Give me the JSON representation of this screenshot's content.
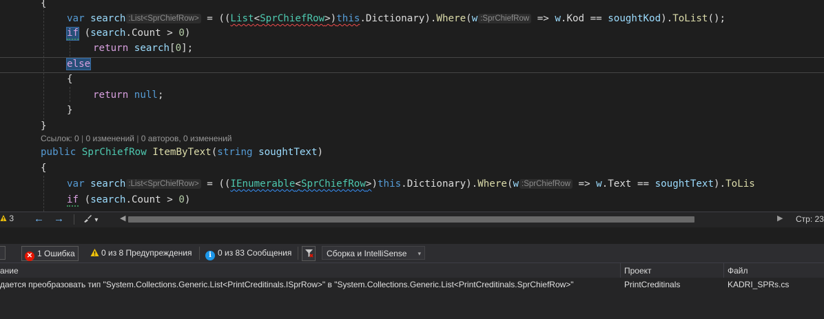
{
  "editor": {
    "l1": {
      "brace": "{"
    },
    "l2": {
      "var": "var",
      "name": "search",
      "hint": ":List<SprChiefRow>",
      "eq": " = ((",
      "list": "List",
      "lt": "<",
      "type": "SprChiefRow",
      "gt": ">",
      "close": ")",
      "this": "this",
      "dict": ".Dictionary).",
      "where": "Where",
      "open": "(",
      "w": "w",
      "whint": ":SprChiefRow",
      "arrow": " => ",
      "w2": "w",
      "dot": ".",
      "kod": "Kod",
      "eqeq": " == ",
      "sought": "soughtKod",
      "end1": ").",
      "tolist": "ToList",
      "end2": "();"
    },
    "l3": {
      "if": "if",
      "rest1": " (",
      "search": "search",
      "rest2": ".Count > ",
      "zero": "0",
      "rest3": ")"
    },
    "l4": {
      "return": "return",
      "sp": " ",
      "search": "search",
      "b1": "[",
      "zero": "0",
      "b2": "];"
    },
    "l5": {
      "else": "else"
    },
    "l6": {
      "brace": "{"
    },
    "l7": {
      "return": "return",
      "sp": " ",
      "null": "null",
      "semi": ";"
    },
    "l8": {
      "brace": "}"
    },
    "l9": {
      "brace": "}"
    },
    "codelens": {
      "refs": "Ссылок: 0",
      "changes": "0 изменений",
      "authors": "0 авторов, 0 изменений"
    },
    "l10": {
      "public": "public",
      "type": "SprChiefRow",
      "method": "ItemByText",
      "open": "(",
      "string": "string",
      "param": "soughtText",
      "close": ")"
    },
    "l11": {
      "brace": "{"
    },
    "l12": {
      "var": "var",
      "name": "search",
      "hint": ":List<SprChiefRow>",
      "eq": " = ((",
      "ienum": "IEnumerable",
      "lt": "<",
      "type": "SprChiefRow",
      "gt": ">",
      "close": ")",
      "this": "this",
      "dict": ".Dictionary).",
      "where": "Where",
      "open": "(",
      "w": "w",
      "whint": ":SprChiefRow",
      "arrow": " => ",
      "w2": "w",
      "dot": ".",
      "text": "Text",
      "eqeq": " == ",
      "sought": "soughtText",
      "end1": ").",
      "tolist": "ToLis"
    },
    "l13": {
      "if": "if",
      "rest1": " (",
      "search": "search",
      "rest2": ".Count > ",
      "zero": "0",
      "rest3": ")"
    }
  },
  "editor_status": {
    "warnings_count": "3",
    "back_icon": "arrow-left-icon",
    "forward_icon": "arrow-right-icon",
    "brush_icon": "brush-icon",
    "dropdown": "▾",
    "position": "Стр: 23"
  },
  "error_list": {
    "toolbar": {
      "errors": "1 Ошибка",
      "warnings": "0 из 8 Предупреждения",
      "messages": "0 из 83 Сообщения",
      "filter_icon": "filter-clear-icon",
      "scope": "Сборка и IntelliSense"
    },
    "columns": {
      "description": "ание",
      "project": "Проект",
      "file": "Файл"
    },
    "rows": [
      {
        "description": "дается преобразовать тип \"System.Collections.Generic.List<PrintCreditinals.ISprRow>\" в \"System.Collections.Generic.List<PrintCreditinals.SprChiefRow>\"",
        "project": "PrintCreditinals",
        "file": "KADRI_SPRs.cs"
      }
    ]
  },
  "colors": {
    "editor_bg": "#1e1e1e",
    "keyword": "#569cd6",
    "control": "#d8a0df",
    "type": "#4ec9b0",
    "method": "#dcdcaa",
    "variable": "#9cdcfe",
    "number": "#b5cea8",
    "error": "#e51400"
  }
}
